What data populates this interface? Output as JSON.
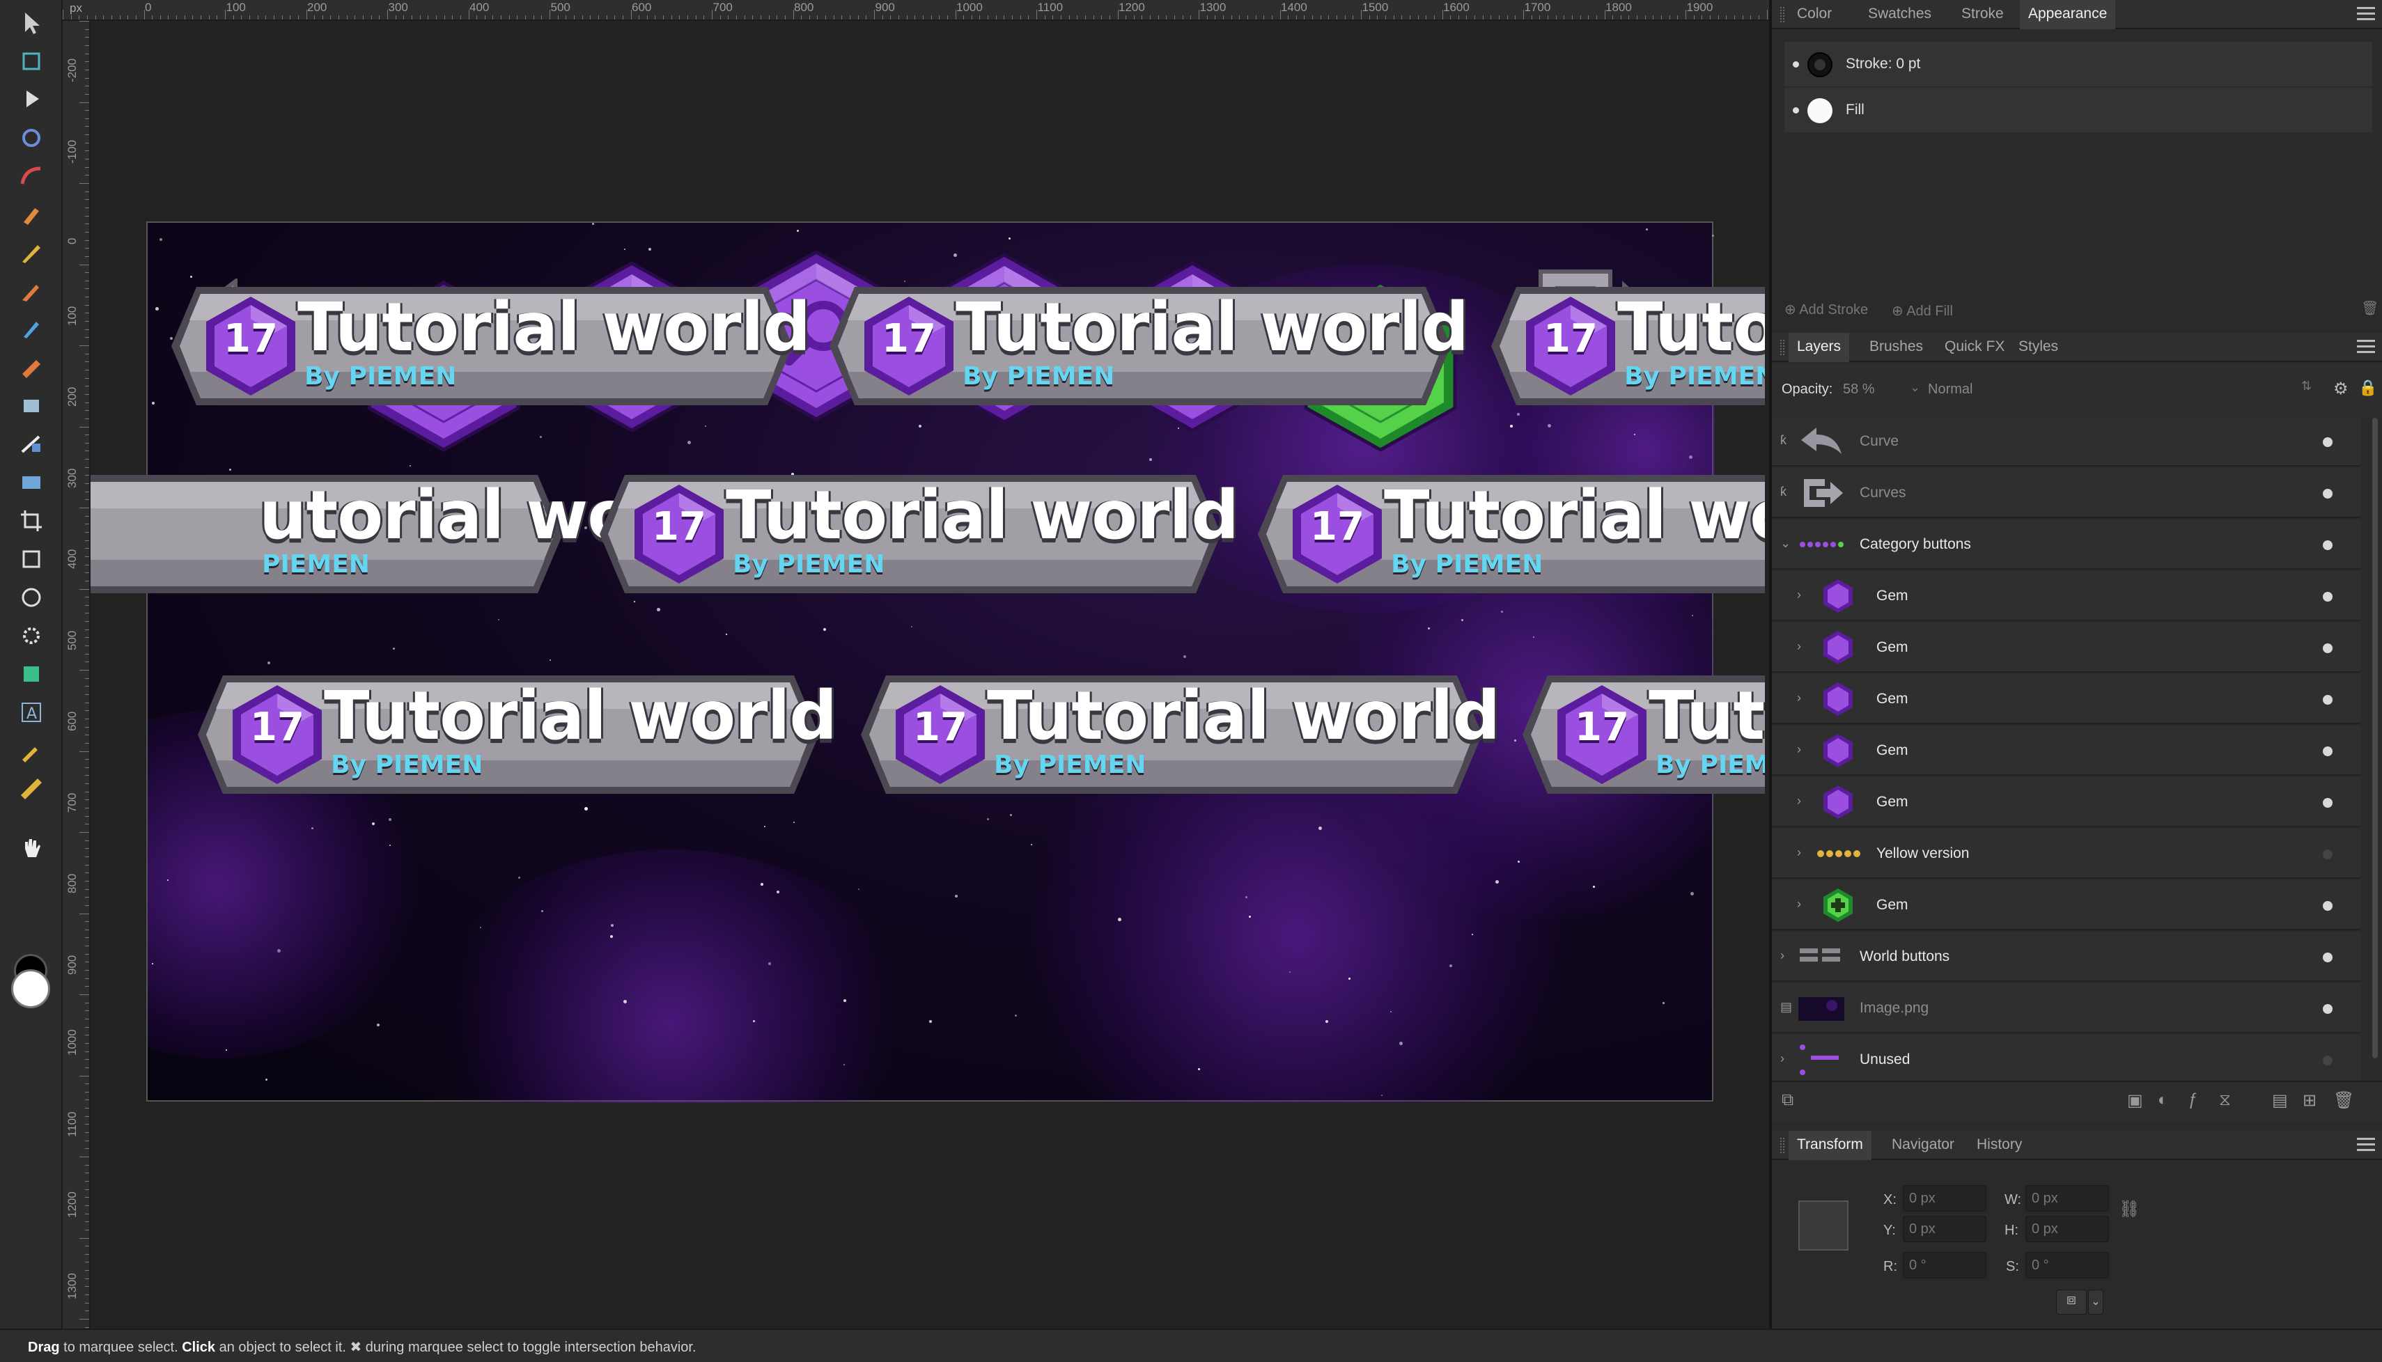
{
  "ruler": {
    "unit": "px",
    "top_labels": [
      "0",
      "100",
      "200",
      "300",
      "400",
      "500",
      "600",
      "700",
      "800",
      "900",
      "1000",
      "1100",
      "1200",
      "1300",
      "1400",
      "1500",
      "1600",
      "1700",
      "1800",
      "1900"
    ],
    "left_labels": [
      "-200",
      "-100",
      "0",
      "100",
      "200",
      "300",
      "400",
      "500",
      "600",
      "700",
      "800",
      "900",
      "1000",
      "1100",
      "1200",
      "1300"
    ]
  },
  "tools": [
    "move-tool-icon",
    "artboard-tool-icon",
    "node-tool-icon",
    "corner-tool-icon",
    "curve-tool-icon",
    "pen-tool-icon",
    "pencil-tool-icon",
    "vector-brush-icon",
    "paint-brush-icon",
    "fill-tool-icon",
    "transparency-tool-icon",
    "gradient-tool-icon",
    "place-image-icon",
    "crop-tool-icon",
    "rectangle-tool-icon",
    "ellipse-tool-icon",
    "cog-shape-icon",
    "shape-builder-icon",
    "text-tool-icon",
    "color-picker-icon",
    "measure-tool-icon",
    "hand-tool-icon"
  ],
  "artwork": {
    "banner_title": "Tutorial world",
    "banner_sub": "By PIEMEN",
    "badge_number": "17",
    "title_partials": [
      "Tuto",
      "utorial world",
      "Tutorial wor",
      "Tuto"
    ],
    "sub_partials": [
      "PIEMEN",
      "By PIEME"
    ],
    "gem_colors": {
      "purple": "#9b4fe0",
      "purple_dark": "#5b1c9e",
      "green": "#55d24a",
      "green_dark": "#1f8a2a"
    }
  },
  "appearance_panel": {
    "tabs": [
      "Color",
      "Swatches",
      "Stroke",
      "Appearance"
    ],
    "active_tab": "Appearance",
    "rows": [
      {
        "label": "Stroke: 0 pt"
      },
      {
        "label": "Fill"
      }
    ],
    "add_stroke": "Add Stroke",
    "add_fill": "Add Fill"
  },
  "layers_panel": {
    "tabs": [
      "Layers",
      "Brushes",
      "Quick FX",
      "Styles"
    ],
    "active_tab": "Layers",
    "opacity_label": "Opacity:",
    "opacity_value": "58 %",
    "blend_mode": "Normal",
    "layers": [
      {
        "name": "Curve",
        "dim": true,
        "visible": true
      },
      {
        "name": "Curves",
        "dim": true,
        "visible": true
      },
      {
        "name": "Category buttons",
        "dim": false,
        "visible": true
      },
      {
        "name": "Gem",
        "dim": false,
        "visible": true
      },
      {
        "name": "Gem",
        "dim": false,
        "visible": true
      },
      {
        "name": "Gem",
        "dim": false,
        "visible": true
      },
      {
        "name": "Gem",
        "dim": false,
        "visible": true
      },
      {
        "name": "Gem",
        "dim": false,
        "visible": true
      },
      {
        "name": "Yellow version",
        "dim": false,
        "visible": false
      },
      {
        "name": "Gem",
        "dim": false,
        "visible": true
      },
      {
        "name": "World buttons",
        "dim": false,
        "visible": true
      },
      {
        "name": "Image.png",
        "dim": true,
        "visible": true
      },
      {
        "name": "Unused",
        "dim": false,
        "visible": false
      }
    ]
  },
  "transform_panel": {
    "tabs": [
      "Transform",
      "Navigator",
      "History"
    ],
    "active_tab": "Transform",
    "x_label": "X:",
    "x_value": "0 px",
    "y_label": "Y:",
    "y_value": "0 px",
    "w_label": "W:",
    "w_value": "0 px",
    "h_label": "H:",
    "h_value": "0 px",
    "r_label": "R:",
    "r_value": "0 °",
    "s_label": "S:",
    "s_value": "0 °"
  },
  "status": {
    "drag": "Drag",
    "drag_text": " to marquee select. ",
    "click": "Click",
    "click_text": " an object to select it. ✖ during marquee select to toggle intersection behavior."
  }
}
